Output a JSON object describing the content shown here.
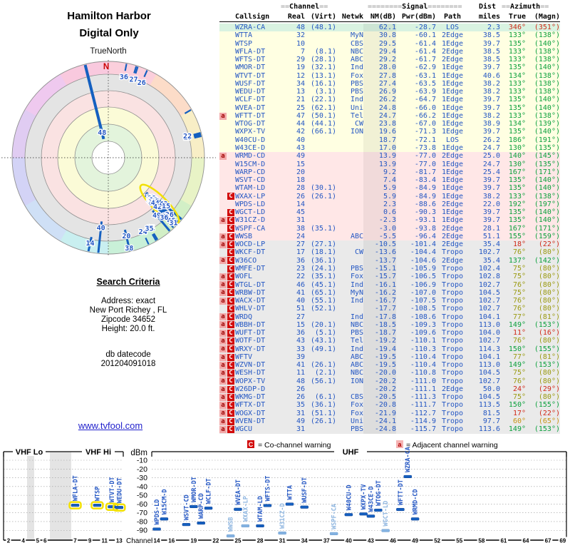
{
  "title": {
    "line1": "Hamilton Harbor",
    "line2": "Digital Only"
  },
  "radar": {
    "axis_label": "TrueNorth",
    "north_label": "N"
  },
  "search_criteria": {
    "heading": "Search Criteria",
    "lines": [
      "Address: exact",
      "New Port Richey , FL",
      "Zipcode 34652",
      "Height: 20.0 ft."
    ],
    "db_label": "db datecode",
    "db_value": "201204091018"
  },
  "link_text": "www.tvfool.com",
  "table": {
    "header": {
      "channel_deco": "==",
      "channel_word": "Channel",
      "signal_deco": "========",
      "signal_word": "Signal",
      "dist_word": "Dist",
      "azimuth_deco": "==",
      "azimuth_word": "Azimuth",
      "cols": {
        "callsign": "Callsign",
        "real": "Real",
        "virt": "(Virt)",
        "netwk": "Netwk",
        "nm": "NM(dB)",
        "pwr": "Pwr(dBm)",
        "path": "Path",
        "miles": "miles",
        "true": "True",
        "magn": "(Magn)"
      }
    }
  },
  "chart_data": {
    "type": "table",
    "notes": "TV Fool reception report. bg: row band color; mk: warning markers; ac: azimuth text color; fa: faded bar; hl: yellow-highlight bar",
    "stations": [
      {
        "cs": "WZRA-CA",
        "re": "48",
        "vi": "(48.1)",
        "nw": "",
        "nm": "62.1",
        "pw": "-28.7",
        "pa": "LOS",
        "mi": "2.3",
        "tr": "346°",
        "mg": "(351°)",
        "ac": "red",
        "bg": "green",
        "mk": ""
      },
      {
        "cs": "WTTA",
        "re": "32",
        "vi": "",
        "nw": "MyN",
        "nm": "30.8",
        "pw": "-60.1",
        "pa": "2Edge",
        "mi": "38.5",
        "tr": "133°",
        "mg": "(138°)",
        "ac": "green",
        "bg": "yellow",
        "mk": ""
      },
      {
        "cs": "WTSP",
        "re": "10",
        "vi": "",
        "nw": "CBS",
        "nm": "29.5",
        "pw": "-61.4",
        "pa": "1Edge",
        "mi": "39.7",
        "tr": "135°",
        "mg": "(140°)",
        "ac": "green",
        "bg": "yellow",
        "mk": "",
        "hl": true
      },
      {
        "cs": "WFLA-DT",
        "re": "7",
        "vi": "(8.1)",
        "nw": "NBC",
        "nm": "29.4",
        "pw": "-61.4",
        "pa": "2Edge",
        "mi": "38.5",
        "tr": "133°",
        "mg": "(138°)",
        "ac": "green",
        "bg": "yellow",
        "mk": "",
        "hl": true
      },
      {
        "cs": "WFTS-DT",
        "re": "29",
        "vi": "(28.1)",
        "nw": "ABC",
        "nm": "29.2",
        "pw": "-61.7",
        "pa": "2Edge",
        "mi": "38.5",
        "tr": "133°",
        "mg": "(138°)",
        "ac": "green",
        "bg": "yellow",
        "mk": ""
      },
      {
        "cs": "WMOR-DT",
        "re": "19",
        "vi": "(32.1)",
        "nw": "Ind",
        "nm": "28.0",
        "pw": "-62.9",
        "pa": "1Edge",
        "mi": "39.7",
        "tr": "135°",
        "mg": "(140°)",
        "ac": "green",
        "bg": "yellow",
        "mk": ""
      },
      {
        "cs": "WTVT-DT",
        "re": "12",
        "vi": "(13.1)",
        "nw": "Fox",
        "nm": "27.8",
        "pw": "-63.1",
        "pa": "1Edge",
        "mi": "40.6",
        "tr": "134°",
        "mg": "(138°)",
        "ac": "green",
        "bg": "yellow",
        "mk": "",
        "hl": true
      },
      {
        "cs": "WUSF-DT",
        "re": "34",
        "vi": "(16.1)",
        "nw": "PBS",
        "nm": "27.4",
        "pw": "-63.5",
        "pa": "1Edge",
        "mi": "38.2",
        "tr": "133°",
        "mg": "(138°)",
        "ac": "green",
        "bg": "yellow",
        "mk": ""
      },
      {
        "cs": "WEDU-DT",
        "re": "13",
        "vi": "(3.1)",
        "nw": "PBS",
        "nm": "26.9",
        "pw": "-63.9",
        "pa": "1Edge",
        "mi": "38.2",
        "tr": "133°",
        "mg": "(138°)",
        "ac": "green",
        "bg": "yellow",
        "mk": "",
        "hl": true
      },
      {
        "cs": "WCLF-DT",
        "re": "21",
        "vi": "(22.1)",
        "nw": "Ind",
        "nm": "26.2",
        "pw": "-64.7",
        "pa": "1Edge",
        "mi": "39.7",
        "tr": "135°",
        "mg": "(140°)",
        "ac": "green",
        "bg": "yellow",
        "mk": ""
      },
      {
        "cs": "WVEA-DT",
        "re": "25",
        "vi": "(62.1)",
        "nw": "Uni",
        "nm": "24.8",
        "pw": "-66.0",
        "pa": "1Edge",
        "mi": "39.7",
        "tr": "135°",
        "mg": "(140°)",
        "ac": "green",
        "bg": "yellow",
        "mk": ""
      },
      {
        "cs": "WFTT-DT",
        "re": "47",
        "vi": "(50.1)",
        "nw": "Tel",
        "nm": "24.7",
        "pw": "-66.2",
        "pa": "1Edge",
        "mi": "38.2",
        "tr": "133°",
        "mg": "(138°)",
        "ac": "green",
        "bg": "yellow",
        "mk": "a"
      },
      {
        "cs": "WTOG-DT",
        "re": "44",
        "vi": "(44.1)",
        "nw": "CW",
        "nm": "23.8",
        "pw": "-67.0",
        "pa": "1Edge",
        "mi": "38.9",
        "tr": "134°",
        "mg": "(139°)",
        "ac": "green",
        "bg": "yellow",
        "mk": ""
      },
      {
        "cs": "WXPX-TV",
        "re": "42",
        "vi": "(66.1)",
        "nw": "ION",
        "nm": "19.6",
        "pw": "-71.3",
        "pa": "1Edge",
        "mi": "39.7",
        "tr": "135°",
        "mg": "(140°)",
        "ac": "green",
        "bg": "yellow",
        "mk": ""
      },
      {
        "cs": "W40CU-D",
        "re": "40",
        "vi": "",
        "nw": "",
        "nm": "18.7",
        "pw": "-72.1",
        "pa": "LOS",
        "mi": "26.2",
        "tr": "186°",
        "mg": "(191°)",
        "ac": "green",
        "bg": "yellow",
        "mk": ""
      },
      {
        "cs": "W43CE-D",
        "re": "43",
        "vi": "",
        "nw": "",
        "nm": "17.0",
        "pw": "-73.8",
        "pa": "1Edge",
        "mi": "24.7",
        "tr": "130°",
        "mg": "(135°)",
        "ac": "green",
        "bg": "yellow",
        "mk": ""
      },
      {
        "cs": "WRMD-CD",
        "re": "49",
        "vi": "",
        "nw": "",
        "nm": "13.9",
        "pw": "-77.0",
        "pa": "2Edge",
        "mi": "25.0",
        "tr": "140°",
        "mg": "(145°)",
        "ac": "green",
        "bg": "pink",
        "mk": "a"
      },
      {
        "cs": "W15CM-D",
        "re": "15",
        "vi": "",
        "nw": "",
        "nm": "13.9",
        "pw": "-77.0",
        "pa": "1Edge",
        "mi": "24.7",
        "tr": "130°",
        "mg": "(135°)",
        "ac": "green",
        "bg": "pink",
        "mk": ""
      },
      {
        "cs": "WARP-CD",
        "re": "20",
        "vi": "",
        "nw": "",
        "nm": "9.2",
        "pw": "-81.7",
        "pa": "1Edge",
        "mi": "25.4",
        "tr": "167°",
        "mg": "(171°)",
        "ac": "green",
        "bg": "pink",
        "mk": ""
      },
      {
        "cs": "WSVT-CD",
        "re": "18",
        "vi": "",
        "nw": "",
        "nm": "7.4",
        "pw": "-83.4",
        "pa": "1Edge",
        "mi": "39.7",
        "tr": "135°",
        "mg": "(140°)",
        "ac": "green",
        "bg": "pink",
        "mk": ""
      },
      {
        "cs": "WTAM-LD",
        "re": "28",
        "vi": "(30.1)",
        "nw": "",
        "nm": "5.9",
        "pw": "-84.9",
        "pa": "1Edge",
        "mi": "39.7",
        "tr": "135°",
        "mg": "(140°)",
        "ac": "green",
        "bg": "pink",
        "mk": ""
      },
      {
        "cs": "WXAX-LP",
        "re": "26",
        "vi": "(26.1)",
        "nw": "",
        "nm": "5.9",
        "pw": "-84.9",
        "pa": "1Edge",
        "mi": "38.2",
        "tr": "133°",
        "mg": "(138°)",
        "ac": "green",
        "bg": "pink",
        "mk": "C",
        "fa": true
      },
      {
        "cs": "WPDS-LD",
        "re": "14",
        "vi": "",
        "nw": "",
        "nm": "2.3",
        "pw": "-88.6",
        "pa": "2Edge",
        "mi": "22.0",
        "tr": "192°",
        "mg": "(197°)",
        "ac": "green",
        "bg": "pink",
        "mk": ""
      },
      {
        "cs": "WGCT-LD",
        "re": "45",
        "vi": "",
        "nw": "",
        "nm": "0.6",
        "pw": "-90.3",
        "pa": "1Edge",
        "mi": "39.7",
        "tr": "135°",
        "mg": "(140°)",
        "ac": "green",
        "bg": "pink",
        "mk": "C",
        "fa": true
      },
      {
        "cs": "W31CZ-D",
        "re": "31",
        "vi": "",
        "nw": "",
        "nm": "-2.3",
        "pw": "-93.1",
        "pa": "1Edge",
        "mi": "39.7",
        "tr": "135°",
        "mg": "(140°)",
        "ac": "green",
        "bg": "pink",
        "mk": "aC",
        "fa": true
      },
      {
        "cs": "WSPF-CA",
        "re": "38",
        "vi": "(35.1)",
        "nw": "",
        "nm": "-3.0",
        "pw": "-93.8",
        "pa": "2Edge",
        "mi": "28.1",
        "tr": "167°",
        "mg": "(171°)",
        "ac": "green",
        "bg": "pink",
        "mk": "C",
        "fa": true
      },
      {
        "cs": "WWSB",
        "re": "24",
        "vi": "",
        "nw": "ABC",
        "nm": "-5.5",
        "pw": "-96.4",
        "pa": "2Edge",
        "mi": "51.1",
        "tr": "155°",
        "mg": "(159°)",
        "ac": "green",
        "bg": "pink",
        "mk": "aC",
        "fa": true
      },
      {
        "cs": "WOCD-LP",
        "re": "27",
        "vi": "(27.1)",
        "nw": "",
        "nm": "-10.5",
        "pw": "-101.4",
        "pa": "2Edge",
        "mi": "35.4",
        "tr": "18°",
        "mg": "(22°)",
        "ac": "red",
        "bg": "gray",
        "mk": "aC"
      },
      {
        "cs": "WKCF-DT",
        "re": "17",
        "vi": "(18.1)",
        "nw": "CW",
        "nm": "-13.6",
        "pw": "-104.4",
        "pa": "Tropo",
        "mi": "102.7",
        "tr": "76°",
        "mg": "(80°)",
        "ac": "olive",
        "bg": "gray",
        "mk": "C"
      },
      {
        "cs": "W36CO",
        "re": "36",
        "vi": "(36.1)",
        "nw": "",
        "nm": "-13.7",
        "pw": "-104.6",
        "pa": "2Edge",
        "mi": "35.4",
        "tr": "137°",
        "mg": "(142°)",
        "ac": "green",
        "bg": "gray",
        "mk": "aC"
      },
      {
        "cs": "WMFE-DT",
        "re": "23",
        "vi": "(24.1)",
        "nw": "PBS",
        "nm": "-15.1",
        "pw": "-105.9",
        "pa": "Tropo",
        "mi": "102.4",
        "tr": "75°",
        "mg": "(80°)",
        "ac": "olive",
        "bg": "gray",
        "mk": "C"
      },
      {
        "cs": "WOFL",
        "re": "22",
        "vi": "(35.1)",
        "nw": "Fox",
        "nm": "-15.7",
        "pw": "-106.5",
        "pa": "Tropo",
        "mi": "102.8",
        "tr": "75°",
        "mg": "(80°)",
        "ac": "olive",
        "bg": "gray",
        "mk": "aC"
      },
      {
        "cs": "WTGL-DT",
        "re": "46",
        "vi": "(45.1)",
        "nw": "Ind",
        "nm": "-16.1",
        "pw": "-106.9",
        "pa": "Tropo",
        "mi": "102.7",
        "tr": "76°",
        "mg": "(80°)",
        "ac": "olive",
        "bg": "gray",
        "mk": "aC"
      },
      {
        "cs": "WRBW-DT",
        "re": "41",
        "vi": "(65.1)",
        "nw": "MyN",
        "nm": "-16.2",
        "pw": "-107.0",
        "pa": "Tropo",
        "mi": "104.5",
        "tr": "75°",
        "mg": "(80°)",
        "ac": "olive",
        "bg": "gray",
        "mk": "aC"
      },
      {
        "cs": "WACX-DT",
        "re": "40",
        "vi": "(55.1)",
        "nw": "Ind",
        "nm": "-16.7",
        "pw": "-107.5",
        "pa": "Tropo",
        "mi": "102.7",
        "tr": "76°",
        "mg": "(80°)",
        "ac": "olive",
        "bg": "gray",
        "mk": "aC"
      },
      {
        "cs": "WHLV-DT",
        "re": "51",
        "vi": "(52.1)",
        "nw": "",
        "nm": "-17.7",
        "pw": "-108.5",
        "pa": "Tropo",
        "mi": "102.7",
        "tr": "76°",
        "mg": "(80°)",
        "ac": "olive",
        "bg": "gray",
        "mk": "C"
      },
      {
        "cs": "WRDQ",
        "re": "27",
        "vi": "",
        "nw": "Ind",
        "nm": "-17.8",
        "pw": "-108.6",
        "pa": "Tropo",
        "mi": "104.1",
        "tr": "77°",
        "mg": "(81°)",
        "ac": "olive",
        "bg": "gray",
        "mk": "aC"
      },
      {
        "cs": "WBBH-DT",
        "re": "15",
        "vi": "(20.1)",
        "nw": "NBC",
        "nm": "-18.5",
        "pw": "-109.3",
        "pa": "Tropo",
        "mi": "113.0",
        "tr": "149°",
        "mg": "(153°)",
        "ac": "green",
        "bg": "gray",
        "mk": "aC"
      },
      {
        "cs": "WUFT-DT",
        "re": "36",
        "vi": "(5.1)",
        "nw": "PBS",
        "nm": "-18.7",
        "pw": "-109.6",
        "pa": "Tropo",
        "mi": "104.0",
        "tr": "11°",
        "mg": "(16°)",
        "ac": "red",
        "bg": "gray",
        "mk": "aC"
      },
      {
        "cs": "WOTF-DT",
        "re": "43",
        "vi": "(43.1)",
        "nw": "Tel",
        "nm": "-19.2",
        "pw": "-110.1",
        "pa": "Tropo",
        "mi": "102.7",
        "tr": "76°",
        "mg": "(80°)",
        "ac": "olive",
        "bg": "gray",
        "mk": "aC"
      },
      {
        "cs": "WRXY-DT",
        "re": "33",
        "vi": "(49.1)",
        "nw": "Ind",
        "nm": "-19.4",
        "pw": "-110.3",
        "pa": "Tropo",
        "mi": "114.3",
        "tr": "150°",
        "mg": "(155°)",
        "ac": "green",
        "bg": "gray",
        "mk": "aC"
      },
      {
        "cs": "WFTV",
        "re": "39",
        "vi": "",
        "nw": "ABC",
        "nm": "-19.5",
        "pw": "-110.4",
        "pa": "Tropo",
        "mi": "104.1",
        "tr": "77°",
        "mg": "(81°)",
        "ac": "olive",
        "bg": "gray",
        "mk": "aC"
      },
      {
        "cs": "WZVN-DT",
        "re": "41",
        "vi": "(26.1)",
        "nw": "ABC",
        "nm": "-19.5",
        "pw": "-110.4",
        "pa": "Tropo",
        "mi": "113.0",
        "tr": "149°",
        "mg": "(153°)",
        "ac": "green",
        "bg": "gray",
        "mk": "aC"
      },
      {
        "cs": "WESH-DT",
        "re": "11",
        "vi": "(2.1)",
        "nw": "NBC",
        "nm": "-20.0",
        "pw": "-110.8",
        "pa": "Tropo",
        "mi": "104.5",
        "tr": "75°",
        "mg": "(80°)",
        "ac": "olive",
        "bg": "gray",
        "mk": "aC"
      },
      {
        "cs": "WOPX-TV",
        "re": "48",
        "vi": "(56.1)",
        "nw": "ION",
        "nm": "-20.2",
        "pw": "-111.0",
        "pa": "Tropo",
        "mi": "102.7",
        "tr": "76°",
        "mg": "(80°)",
        "ac": "olive",
        "bg": "gray",
        "mk": "aC"
      },
      {
        "cs": "W26DP-D",
        "re": "26",
        "vi": "",
        "nw": "",
        "nm": "-20.2",
        "pw": "-111.1",
        "pa": "2Edge",
        "mi": "50.0",
        "tr": "24°",
        "mg": "(29°)",
        "ac": "red",
        "bg": "gray",
        "mk": "aC"
      },
      {
        "cs": "WKMG-DT",
        "re": "26",
        "vi": "(6.1)",
        "nw": "CBS",
        "nm": "-20.5",
        "pw": "-111.3",
        "pa": "Tropo",
        "mi": "104.5",
        "tr": "75°",
        "mg": "(80°)",
        "ac": "olive",
        "bg": "gray",
        "mk": "aC"
      },
      {
        "cs": "WFTX-DT",
        "re": "35",
        "vi": "(36.1)",
        "nw": "Fox",
        "nm": "-20.8",
        "pw": "-111.7",
        "pa": "Tropo",
        "mi": "113.5",
        "tr": "150°",
        "mg": "(155°)",
        "ac": "green",
        "bg": "gray",
        "mk": "aC"
      },
      {
        "cs": "WOGX-DT",
        "re": "31",
        "vi": "(51.1)",
        "nw": "Fox",
        "nm": "-21.9",
        "pw": "-112.7",
        "pa": "Tropo",
        "mi": "81.5",
        "tr": "17°",
        "mg": "(22°)",
        "ac": "red",
        "bg": "gray",
        "mk": "aC"
      },
      {
        "cs": "WVEN-DT",
        "re": "49",
        "vi": "(26.1)",
        "nw": "Uni",
        "nm": "-24.1",
        "pw": "-114.9",
        "pa": "Tropo",
        "mi": "97.7",
        "tr": "60°",
        "mg": "(65°)",
        "ac": "amber",
        "bg": "gray",
        "mk": "aC"
      },
      {
        "cs": "WGCU",
        "re": "31",
        "vi": "",
        "nw": "PBS",
        "nm": "-24.8",
        "pw": "-115.7",
        "pa": "Tropo",
        "mi": "113.6",
        "tr": "149°",
        "mg": "(153°)",
        "ac": "green",
        "bg": "gray",
        "mk": "aC"
      }
    ]
  },
  "signal_chart": {
    "ylabel": "dBm",
    "xlabel": "Channel",
    "dbm_ticks": [
      -10,
      -20,
      -30,
      -40,
      -50,
      -60,
      -70,
      -80,
      -90
    ],
    "vhf": {
      "label_lo": "VHF Lo",
      "label_hi": "VHF Hi",
      "ticks": [
        2,
        4,
        5,
        6,
        7,
        9,
        11,
        13
      ]
    },
    "uhf": {
      "label": "UHF",
      "ticks": [
        14,
        16,
        19,
        22,
        25,
        28,
        31,
        34,
        37,
        40,
        43,
        46,
        49,
        52,
        55,
        58,
        61,
        64,
        67,
        69
      ]
    },
    "legend": {
      "c_symbol": "C",
      "c_text": "= Co-channel warning",
      "a_symbol": "a",
      "a_text": "= Adjacent channel warning"
    }
  },
  "colors": {
    "text_blue": "#2356c3",
    "az_green": "#0aa03c",
    "az_red": "#d02818",
    "az_olive": "#9a9a10",
    "az_amber": "#c69312",
    "bar_blue": "#1560c0",
    "bar_faded": "#85b3e2",
    "highlight_yellow": "#f2e000",
    "marker_red": "#d20a0a",
    "marker_pink": "#f2a9a9",
    "row_green": "#d9f3e1",
    "row_yellow": "#ffffe2",
    "row_pink": "#ffe7e7",
    "row_gray": "#eaeaea"
  }
}
